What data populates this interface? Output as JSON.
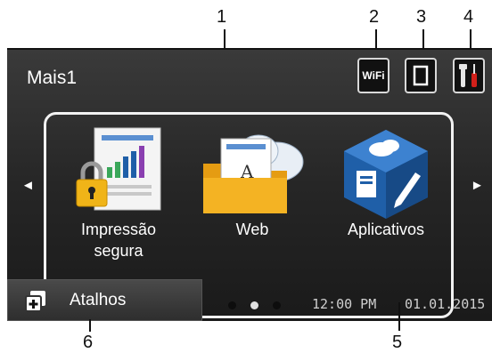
{
  "callouts": [
    "1",
    "2",
    "3",
    "4",
    "5",
    "6"
  ],
  "header": {
    "title": "Mais1",
    "wifi_label": "WiFi"
  },
  "apps": [
    {
      "label_line1": "Impressão",
      "label_line2": "segura",
      "icon": "secure-print-icon"
    },
    {
      "label_line1": "Web",
      "icon": "web-folder-icon"
    },
    {
      "label_line1": "Aplicativos",
      "icon": "apps-cube-icon"
    }
  ],
  "nav": {
    "left": "◄",
    "right": "►"
  },
  "footer": {
    "shortcut_label": "Atalhos",
    "time": "12:00 PM",
    "date": "01.01.2015",
    "page_indicator": {
      "pages": 3,
      "current": 2
    }
  },
  "colors": {
    "accent_blue": "#1f5fa8",
    "folder_yellow": "#f4b323",
    "tools_red": "#d1201a"
  }
}
